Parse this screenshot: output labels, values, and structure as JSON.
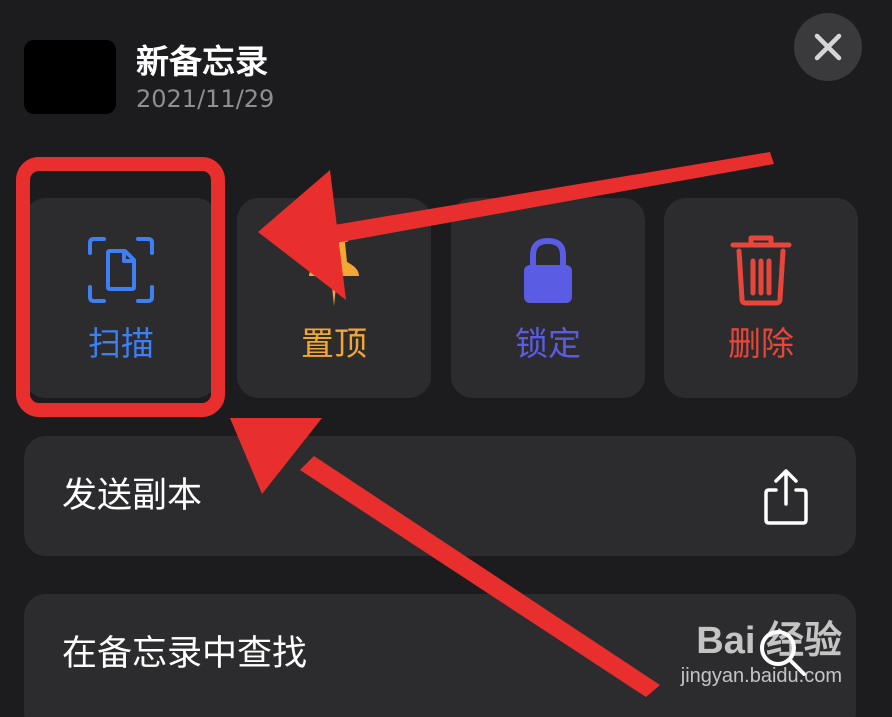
{
  "note": {
    "title": "新备忘录",
    "date": "2021/11/29"
  },
  "actions": [
    {
      "label": "扫描",
      "icon": "scan-document-icon",
      "color": "#3e7ff3"
    },
    {
      "label": "置顶",
      "icon": "pin-icon",
      "color": "#f2a636"
    },
    {
      "label": "锁定",
      "icon": "lock-icon",
      "color": "#5b5ce4"
    },
    {
      "label": "删除",
      "icon": "trash-icon",
      "color": "#e8463a"
    }
  ],
  "menu": {
    "send_copy": "发送副本",
    "find_in_note": "在备忘录中查找"
  },
  "watermark": {
    "logo": "Bai 经验",
    "url": "jingyan.baidu.com"
  },
  "colors": {
    "background": "#1c1c1e",
    "tile": "#2c2c2e",
    "annotation": "#e92e2e"
  }
}
